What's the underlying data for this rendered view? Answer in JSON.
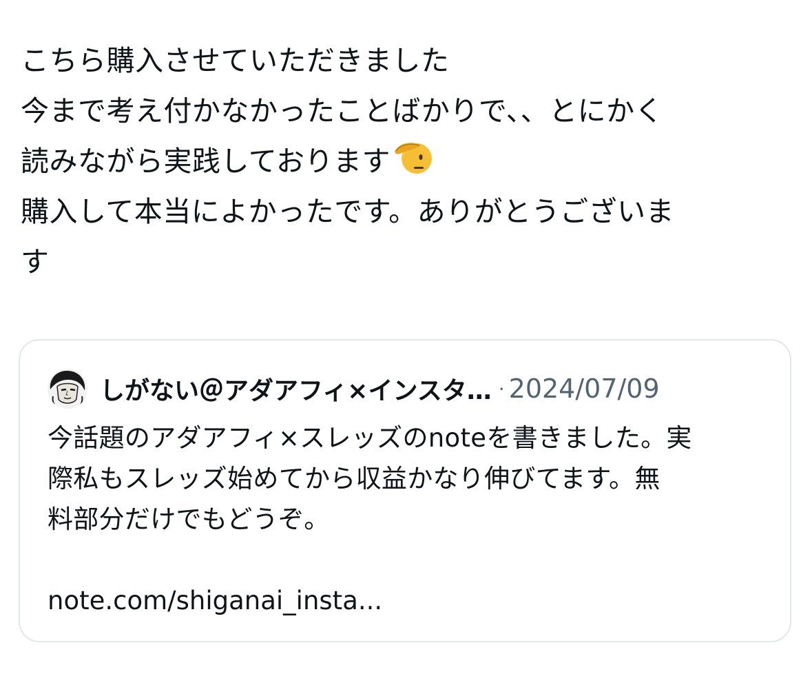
{
  "post": {
    "lines": [
      "こちら購入させていただきました",
      "今まで考え付かなかったことばかりで、、とにかく",
      "読みながら実践しております",
      "購入して本当によかったです。ありがとうございま",
      "す"
    ],
    "emoji": "saluting-face-emoji"
  },
  "quote": {
    "author_name": "しがない＠アダアフィ×インスタ…",
    "separator": "·",
    "date": "2024/07/09",
    "avatar": "avatar-manga-portrait",
    "text_lines": [
      "今話題のアダアフィ×スレッズのnoteを書きました。実",
      "際私もスレッズ始めてから収益かなり伸びてます。無",
      "料部分だけでもどうぞ。"
    ],
    "link_text": "note.com/shiganai_insta..."
  }
}
